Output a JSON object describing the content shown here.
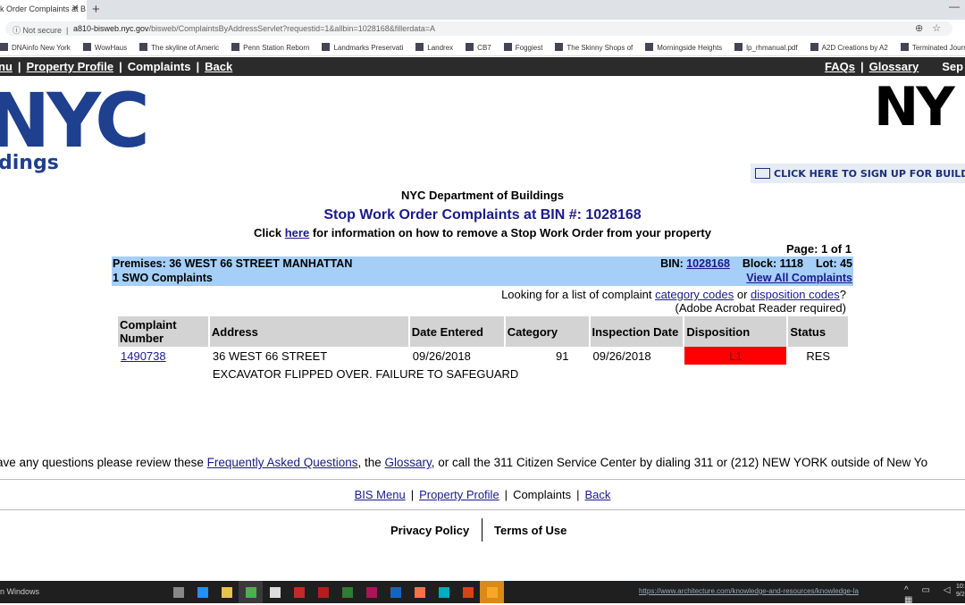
{
  "browser": {
    "tab_title": "k Order Complaints at B",
    "new_tab": "+",
    "not_secure": "Not secure",
    "url_host": "a810-bisweb.nyc.gov",
    "url_path": "/bisweb/ComplaintsByAddressServlet?requestid=1&allbin=1028168&fillerdata=A",
    "bookmarks": [
      "DNAinfo New York",
      "WowHaus",
      "The skyline of Americ",
      "Penn Station Reborn",
      "Landmarks Preservati",
      "Landrex",
      "CB7",
      "Foggiest",
      "The Skinny Shops of",
      "Morningside Heights",
      "lp_rhmanual.pdf",
      "A2D Creations by A2",
      "Terminated Journals"
    ]
  },
  "topnav": {
    "bis_menu": "nu",
    "property_profile": "Property Profile",
    "complaints": "Complaints",
    "back": "Back",
    "faqs": "FAQs",
    "glossary": "Glossary",
    "search": "Sep",
    "sep": "|"
  },
  "logo": {
    "text": "NYC",
    "sub": "dings",
    "right": "NY"
  },
  "signup": "CLICK HERE TO SIGN UP FOR BUILDIN",
  "header": {
    "dept": "NYC Department of Buildings",
    "title": "Stop Work Order Complaints at BIN #: 1028168",
    "click_pre": "Click ",
    "click_link": "here",
    "click_post": " for information on how to remove a Stop Work Order from your property",
    "page": "Page: 1 of 1"
  },
  "premises": {
    "address": "Premises: 36 WEST 66 STREET MANHATTAN",
    "count": "1 SWO Complaints",
    "bin_label": "BIN: ",
    "bin": "1028168",
    "block": "Block: 1118",
    "lot": "Lot: 45",
    "view_all": "View All Complaints"
  },
  "codes": {
    "pre": "Looking for a list of complaint ",
    "category": "category codes",
    "or": " or ",
    "disposition": "disposition codes",
    "q": "?",
    "note": "(Adobe Acrobat Reader required)"
  },
  "table": {
    "headers": [
      "Complaint Number",
      "Address",
      "Date Entered",
      "Category",
      "Inspection Date",
      "Disposition",
      "Status"
    ],
    "rows": [
      {
        "number": "1490738",
        "address": "36 WEST 66 STREET",
        "date_entered": "09/26/2018",
        "category": "91",
        "inspection_date": "09/26/2018",
        "disposition": "L1",
        "status": "RES",
        "description": "EXCAVATOR FLIPPED OVER. FAILURE TO SAFEGUARD"
      }
    ],
    "disposition_color": "#ff0000"
  },
  "faq": {
    "pre": "ave any questions please review these ",
    "faq_link": "Frequently Asked Questions",
    "mid": ", the ",
    "glossary": "Glossary",
    "post": ", or call the 311 Citizen Service Center by dialing 311 or (212) NEW YORK outside of New Yo"
  },
  "bottomnav": {
    "bis_menu": "BIS Menu",
    "property_profile": "Property Profile",
    "complaints": "Complaints",
    "back": "Back",
    "sep": "|"
  },
  "footer": {
    "privacy": "Privacy Policy",
    "terms": "Terms of Use"
  },
  "taskbar": {
    "activate": "n Windows",
    "status_url": "https://www.architecture.com/knowledge-and-resources/knowledge-la",
    "clock_time": "10:",
    "clock_date": "9/2"
  },
  "colors": {
    "nav_bg": "#2b2b2b",
    "premises_bg": "#a6cff8",
    "link": "#1a1a8c",
    "logo": "#1f3f8f"
  }
}
